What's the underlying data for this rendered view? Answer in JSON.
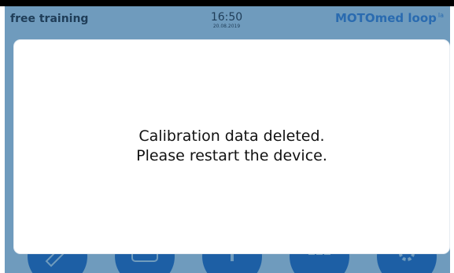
{
  "status_bar": {
    "mode": "free training",
    "time": "16:50",
    "date": "20.08.2019",
    "brand": "MOTOmed loop",
    "brand_suffix": "la"
  },
  "dialog": {
    "line1": "Calibration data deleted.",
    "line2": "Please restart the device."
  },
  "bottom_nav": {
    "buttons": [
      {
        "icon": "therapy-program-icon"
      },
      {
        "icon": "display-icon"
      },
      {
        "icon": "info-icon"
      },
      {
        "icon": "menu-grid-icon"
      },
      {
        "icon": "settings-gear-icon"
      }
    ]
  },
  "colors": {
    "background": "#6f9bbd",
    "nav_button": "#1d5fa5",
    "brand": "#2a6bb0",
    "dialog": "#ffffff"
  }
}
